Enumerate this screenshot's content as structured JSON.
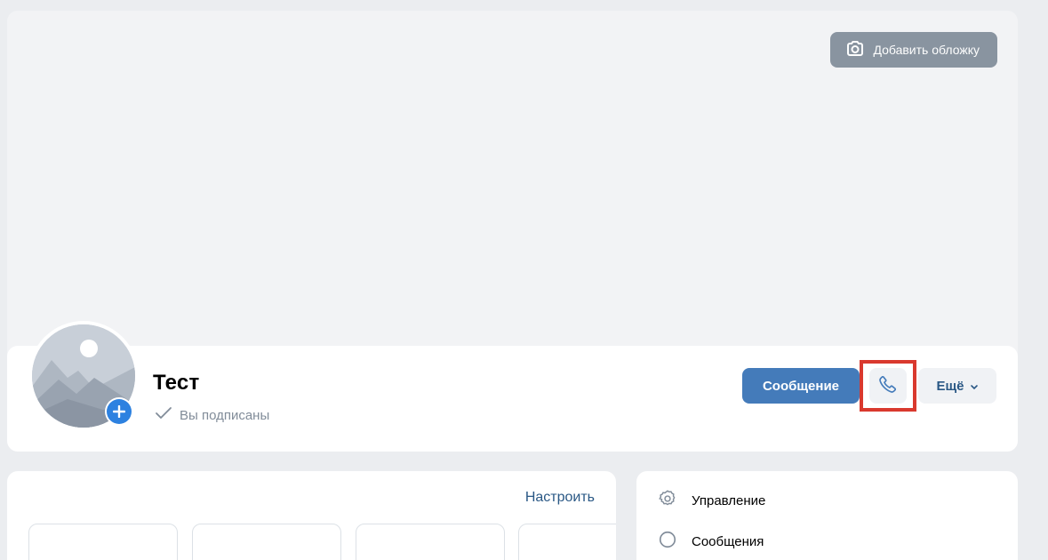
{
  "cover": {
    "add_cover_label": "Добавить обложку"
  },
  "profile": {
    "name": "Тест",
    "subscription_status": "Вы подписаны"
  },
  "actions": {
    "message_label": "Сообщение",
    "more_label": "Ещё"
  },
  "left_panel": {
    "configure_label": "Настроить"
  },
  "right_menu": {
    "items": [
      {
        "label": "Управление",
        "icon": "gear-icon"
      },
      {
        "label": "Сообщения",
        "icon": "message-circle-icon"
      }
    ]
  },
  "colors": {
    "primary_button": "#447bba",
    "link": "#2a5885",
    "highlight": "#d9392e",
    "background": "#ebedf0"
  }
}
